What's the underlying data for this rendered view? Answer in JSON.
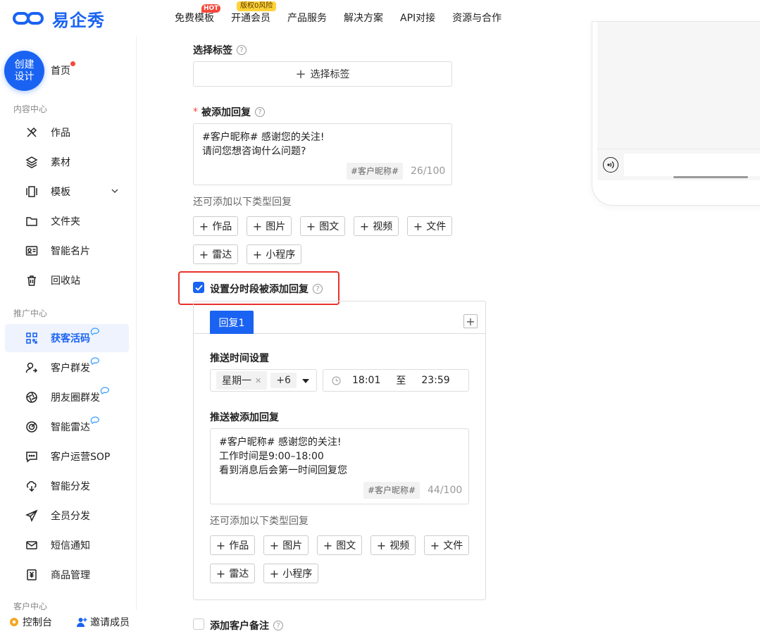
{
  "brand": {
    "name": "易企秀"
  },
  "topnav": [
    {
      "label": "免费模板",
      "badge": "HOT"
    },
    {
      "label": "开通会员",
      "badge": "版权0风险"
    },
    {
      "label": "产品服务"
    },
    {
      "label": "解决方案"
    },
    {
      "label": "API对接"
    },
    {
      "label": "资源与合作"
    }
  ],
  "sidebar": {
    "create_label": "创建设计",
    "home_label": "首页",
    "content_center": "内容中心",
    "content_items": [
      "作品",
      "素材",
      "模板",
      "文件夹",
      "智能名片",
      "回收站"
    ],
    "promo_center": "推广中心",
    "promo_items": [
      "获客活码",
      "客户群发",
      "朋友圈群发",
      "智能雷达",
      "客户运营SOP",
      "智能分发",
      "全员分发",
      "短信通知",
      "商品管理"
    ],
    "customer_center": "客户中心",
    "bottom": {
      "console": "控制台",
      "invite": "邀请成员"
    }
  },
  "form": {
    "tag_label": "选择标签",
    "tag_button": "选择标签",
    "reply_label": "被添加回复",
    "reply_text": [
      "#客户昵称# 感谢您的关注!",
      "请问您想咨询什么问题?"
    ],
    "reply_var_chip": "#客户昵称#",
    "reply_counter": "26/100",
    "extra_hint": "还可添加以下类型回复",
    "types": [
      "作品",
      "图片",
      "图文",
      "视频",
      "文件",
      "雷达",
      "小程序"
    ],
    "timed_reply_label": "设置分时段被添加回复",
    "timed_reply_checked": true,
    "panel": {
      "tab_label": "回复1",
      "tab_add": "+",
      "time_setting_label": "推送时间设置",
      "weekday_chip": "星期一",
      "weekday_more": "+6",
      "time_start": "18:01",
      "time_sep": "至",
      "time_end": "23:59",
      "push_reply_label": "推送被添加回复",
      "push_text": [
        "#客户昵称# 感谢您的关注!",
        "工作时间是9:00–18:00",
        "看到消息后会第一时间回复您"
      ],
      "push_var_chip": "#客户昵称#",
      "push_counter": "44/100",
      "extra_hint": "还可添加以下类型回复"
    },
    "note_label": "添加客户备注",
    "note_checked": false
  },
  "colors": {
    "primary": "#1a63f2",
    "danger": "#e8322c"
  }
}
